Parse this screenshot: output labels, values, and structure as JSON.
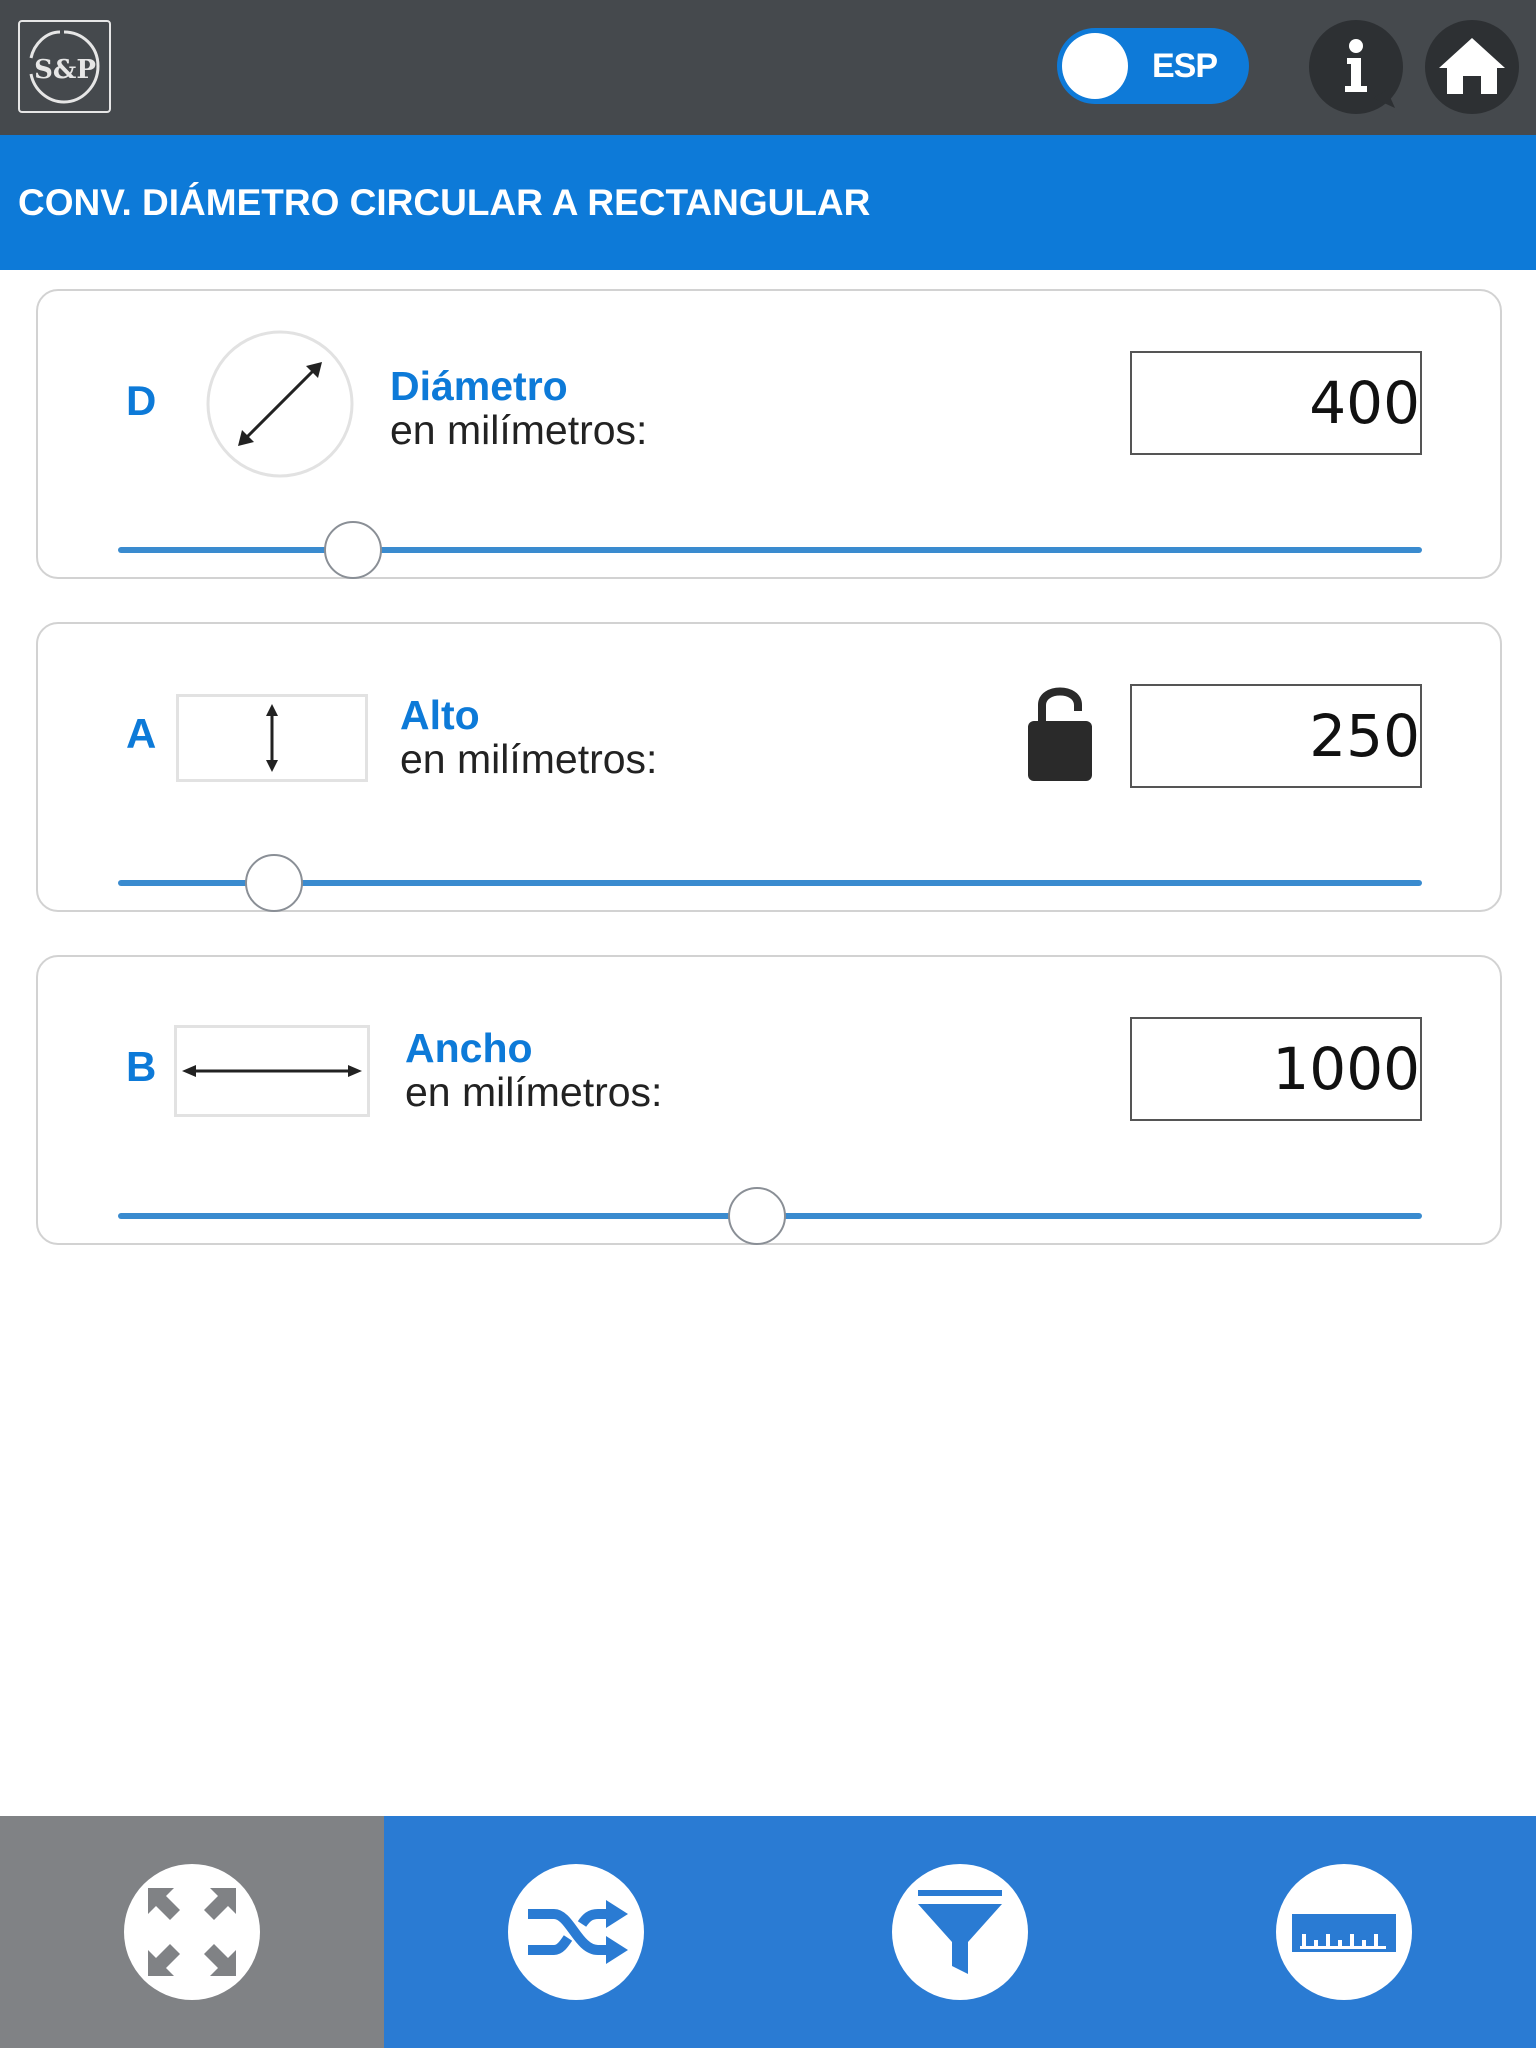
{
  "header": {
    "logo_text": "S&P",
    "language": "ESP",
    "info_icon": "info-icon",
    "home_icon": "home-icon"
  },
  "title": "CONV. DIÁMETRO CIRCULAR A RECTANGULAR",
  "cards": [
    {
      "letter": "D",
      "icon": "diameter-icon",
      "label": "Diámetro",
      "sublabel": "en milímetros:",
      "value": "400",
      "slider_fraction": 0.18
    },
    {
      "letter": "A",
      "icon": "height-arrow-icon",
      "label": "Alto",
      "sublabel": "en milímetros:",
      "value": "250",
      "lock_icon": "unlocked-padlock-icon",
      "slider_fraction": 0.12
    },
    {
      "letter": "B",
      "icon": "width-arrow-icon",
      "label": "Ancho",
      "sublabel": "en milímetros:",
      "value": "1000",
      "slider_fraction": 0.49
    }
  ],
  "bottom_tabs": [
    {
      "icon": "expand-arrows-icon",
      "active": true
    },
    {
      "icon": "shuffle-icon",
      "active": false
    },
    {
      "icon": "filter-funnel-icon",
      "active": false
    },
    {
      "icon": "ruler-icon",
      "active": false
    }
  ],
  "colors": {
    "header_bg": "#45494d",
    "accent_blue": "#0d7ad8",
    "active_tab_bg": "#808285"
  }
}
